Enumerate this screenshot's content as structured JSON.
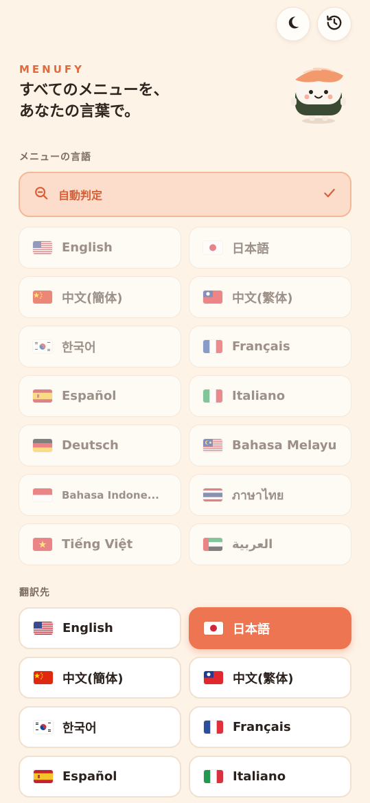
{
  "header": {
    "brand": "MENUFY",
    "headline_line1": "すべてのメニューを、",
    "headline_line2": "あなたの言葉で。",
    "theme_toggle_icon": "moon-icon",
    "history_icon": "history-icon"
  },
  "source_section": {
    "label": "メニューの言語",
    "auto_detect": {
      "label": "自動判定",
      "icon": "search-icon",
      "selected": true,
      "check_icon": "check-icon"
    },
    "languages": [
      {
        "label": "English",
        "flag": "us"
      },
      {
        "label": "日本語",
        "flag": "jp"
      },
      {
        "label": "中文(簡体)",
        "flag": "cn"
      },
      {
        "label": "中文(繁体)",
        "flag": "tw"
      },
      {
        "label": "한국어",
        "flag": "kr"
      },
      {
        "label": "Français",
        "flag": "fr"
      },
      {
        "label": "Español",
        "flag": "es"
      },
      {
        "label": "Italiano",
        "flag": "it"
      },
      {
        "label": "Deutsch",
        "flag": "de"
      },
      {
        "label": "Bahasa Melayu",
        "flag": "my"
      },
      {
        "label": "Bahasa Indone...",
        "flag": "id"
      },
      {
        "label": "ภาษาไทย",
        "flag": "th"
      },
      {
        "label": "Tiếng Việt",
        "flag": "vn"
      },
      {
        "label": "العربية",
        "flag": "ae"
      }
    ]
  },
  "target_section": {
    "label": "翻訳先",
    "selected": "日本語",
    "languages": [
      {
        "label": "English",
        "flag": "us"
      },
      {
        "label": "日本語",
        "flag": "jp"
      },
      {
        "label": "中文(簡体)",
        "flag": "cn"
      },
      {
        "label": "中文(繁体)",
        "flag": "tw"
      },
      {
        "label": "한국어",
        "flag": "kr"
      },
      {
        "label": "Français",
        "flag": "fr"
      },
      {
        "label": "Español",
        "flag": "es"
      },
      {
        "label": "Italiano",
        "flag": "it"
      }
    ]
  },
  "colors": {
    "background": "#fdf3e7",
    "accent": "#ee7551",
    "brand": "#e06a3e"
  }
}
